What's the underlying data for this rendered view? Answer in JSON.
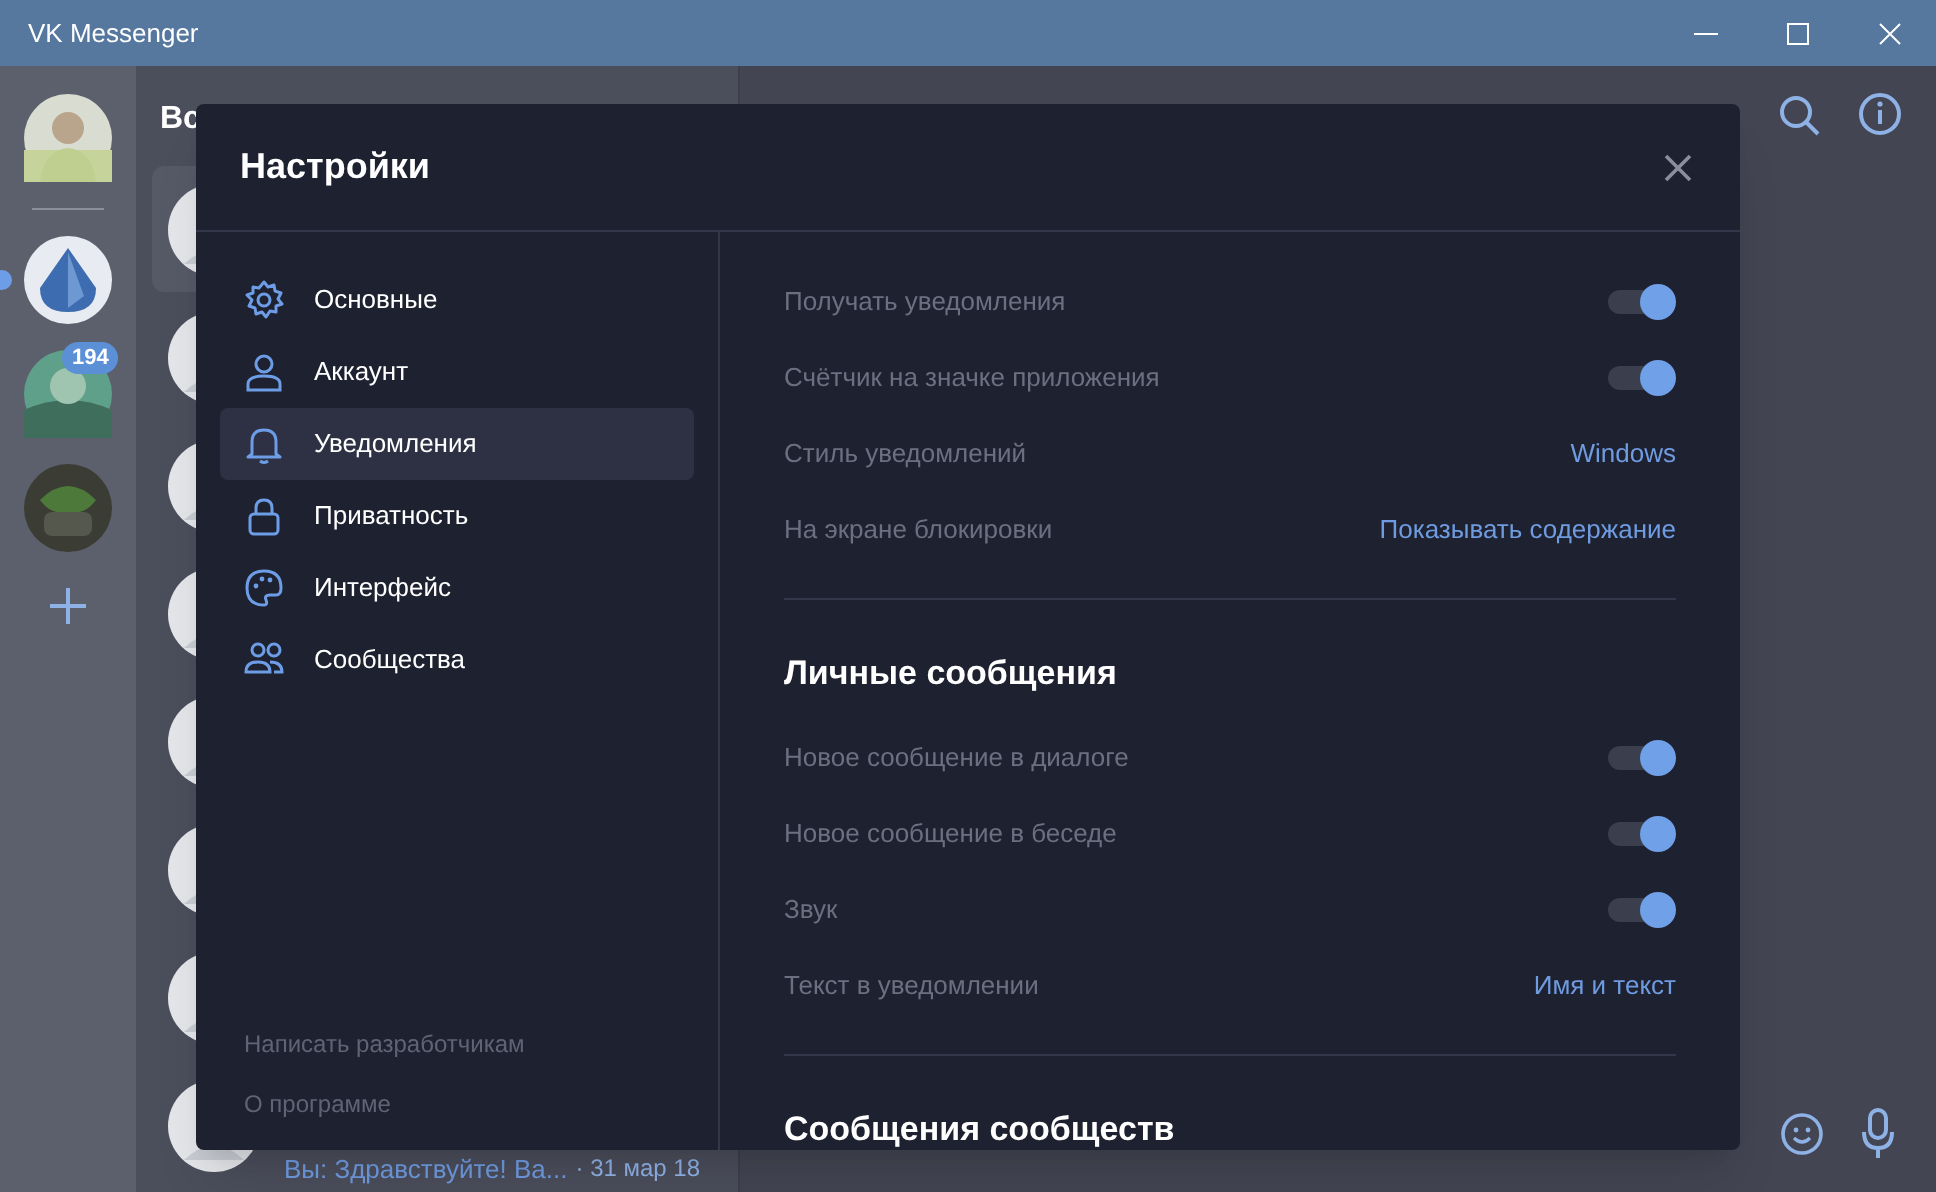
{
  "window": {
    "title": "VK Messenger"
  },
  "rail": [
    {
      "kind": "profile",
      "active": false
    },
    {
      "kind": "community",
      "active": true
    },
    {
      "kind": "community",
      "active": false,
      "badge": "194"
    },
    {
      "kind": "community",
      "active": false
    }
  ],
  "chat_list": {
    "title": "Вс",
    "items": [
      {
        "selected": true
      },
      {
        "selected": false
      },
      {
        "selected": false
      },
      {
        "selected": false
      },
      {
        "selected": false
      },
      {
        "selected": false
      },
      {
        "selected": false
      },
      {
        "selected": false,
        "preview": "Вы: Здравствуйте! Ва...",
        "date": "· 31 мар 18"
      }
    ]
  },
  "settings": {
    "title": "Настройки",
    "nav": [
      {
        "label": "Основные",
        "selected": false
      },
      {
        "label": "Аккаунт",
        "selected": false
      },
      {
        "label": "Уведомления",
        "selected": true
      },
      {
        "label": "Приватность",
        "selected": false
      },
      {
        "label": "Интерфейс",
        "selected": false
      },
      {
        "label": "Сообщества",
        "selected": false
      }
    ],
    "footer_links": [
      "Написать разработчикам",
      "О программе"
    ],
    "sections": [
      {
        "rows": [
          {
            "label": "Получать уведомления",
            "kind": "toggle",
            "on": true
          },
          {
            "label": "Счётчик на значке приложения",
            "kind": "toggle",
            "on": true
          },
          {
            "label": "Стиль уведомлений",
            "kind": "value",
            "value": "Windows"
          },
          {
            "label": "На экране блокировки",
            "kind": "value",
            "value": "Показывать содержание"
          }
        ]
      },
      {
        "heading": "Личные сообщения",
        "rows": [
          {
            "label": "Новое сообщение в диалоге",
            "kind": "toggle",
            "on": true
          },
          {
            "label": "Новое сообщение в беседе",
            "kind": "toggle",
            "on": true
          },
          {
            "label": "Звук",
            "kind": "toggle",
            "on": true
          },
          {
            "label": "Текст в уведомлении",
            "kind": "value",
            "value": "Имя и текст"
          }
        ]
      },
      {
        "heading": "Сообщения сообществ"
      }
    ]
  }
}
